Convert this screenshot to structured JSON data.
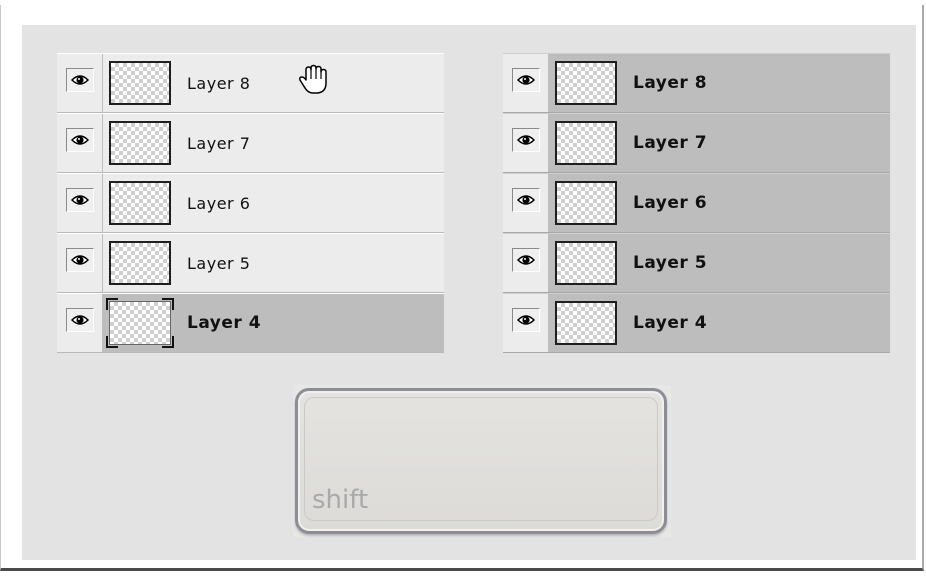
{
  "left_panel": {
    "layers": [
      {
        "label": "Layer 8",
        "selected": false
      },
      {
        "label": "Layer 7",
        "selected": false
      },
      {
        "label": "Layer 6",
        "selected": false
      },
      {
        "label": "Layer 5",
        "selected": false
      },
      {
        "label": "Layer 4",
        "selected": true
      }
    ]
  },
  "right_panel": {
    "layers": [
      {
        "label": "Layer 8",
        "selected": true
      },
      {
        "label": "Layer 7",
        "selected": true
      },
      {
        "label": "Layer 6",
        "selected": true
      },
      {
        "label": "Layer 5",
        "selected": true
      },
      {
        "label": "Layer 4",
        "selected": true
      }
    ]
  },
  "shift_key": {
    "label": "shift"
  },
  "icons": {
    "visibility": "eye-icon",
    "cursor": "hand-cursor-icon"
  },
  "colors": {
    "panel_bg": "#e3e3e3",
    "selected_row": "#bdbdbd",
    "row_bg": "#ececec"
  }
}
